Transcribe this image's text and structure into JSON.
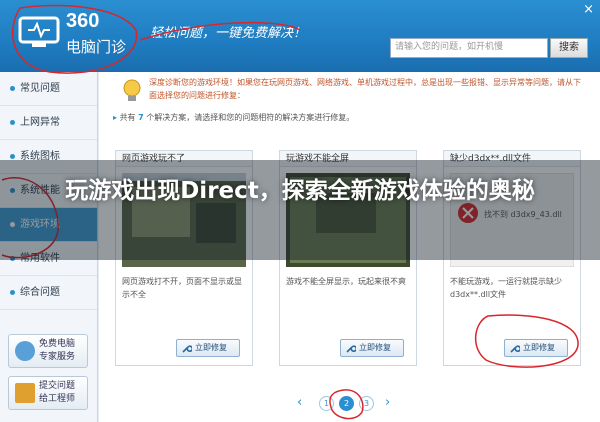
{
  "header": {
    "logo_number": "360",
    "logo_text": "电脑门诊",
    "slogan": "轻松问题，一键免费解决！",
    "close_glyph": "×",
    "search_placeholder": "请输入您的问题，如开机慢",
    "search_button": "搜索"
  },
  "sidebar": {
    "items": [
      {
        "label": "常见问题"
      },
      {
        "label": "上网异常"
      },
      {
        "label": "系统图标"
      },
      {
        "label": "系统性能"
      },
      {
        "label": "游戏环境"
      },
      {
        "label": "常用软件"
      },
      {
        "label": "综合问题"
      }
    ],
    "buttons": [
      {
        "line1": "免费电脑",
        "line2": "专家服务"
      },
      {
        "line1": "提交问题",
        "line2": "给工程师"
      }
    ]
  },
  "main": {
    "notice": "深度诊断您的游戏环境！如果您在玩网页游戏、网络游戏、单机游戏过程中，总是出现一些报错、显示异常等问题，请从下面选择您的问题进行修复：",
    "count_prefix": "共有",
    "count_number": "7",
    "count_suffix": "个解决方案，请选择和您的问题相符的解决方案进行修复。",
    "cards": [
      {
        "title": "网页游戏玩不了",
        "desc": "网页游戏打不开，页面不显示或显示不全",
        "button": "立即修复"
      },
      {
        "title": "玩游戏不能全屏",
        "desc": "游戏不能全屏显示，玩起来很不爽",
        "button": "立即修复"
      },
      {
        "title": "缺少d3dx**.dll文件",
        "desc": "不能玩游戏，一运行就提示缺少d3dx**.dll文件",
        "button": "立即修复",
        "img_label": "找不到 d3dx9_43.dll"
      }
    ],
    "pager": {
      "prev": "‹",
      "pages": [
        "1",
        "2",
        "3"
      ],
      "current": "2",
      "next": "›"
    }
  },
  "headline": "玩游戏出现Direct，探索全新游戏体验的奥秘",
  "colors": {
    "brand_blue": "#2a8fd0",
    "notice_orange": "#c0552a",
    "annotation_red": "#d9262b"
  }
}
